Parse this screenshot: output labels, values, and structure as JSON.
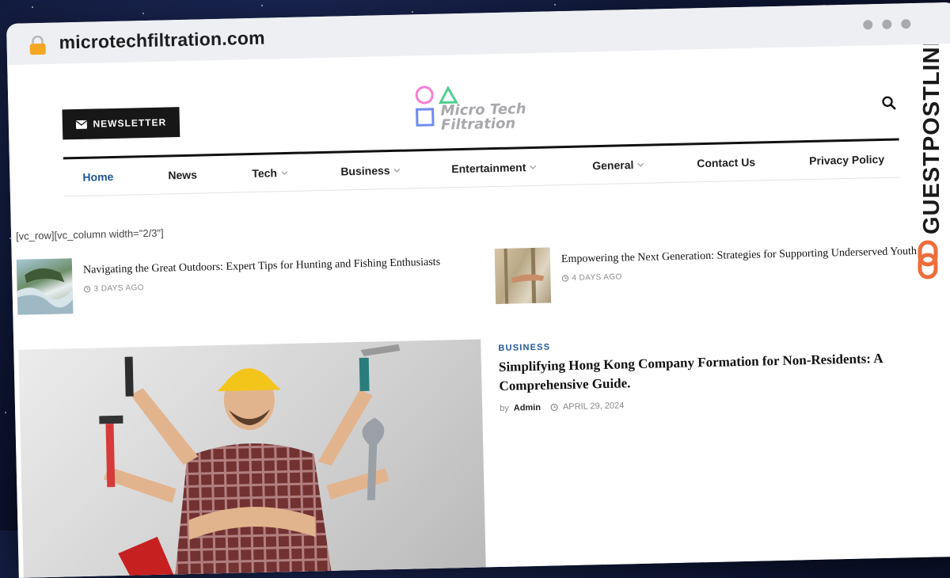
{
  "browser": {
    "url": "microtechfiltration.com"
  },
  "header": {
    "newsletter_label": "NEWSLETTER",
    "logo_line1": "Micro Tech",
    "logo_line2": "Filtration"
  },
  "nav": {
    "items": [
      {
        "label": "Home",
        "active": true
      },
      {
        "label": "News"
      },
      {
        "label": "Tech",
        "dropdown": true
      },
      {
        "label": "Business",
        "dropdown": true
      },
      {
        "label": "Entertainment",
        "dropdown": true
      },
      {
        "label": "General",
        "dropdown": true
      },
      {
        "label": "Contact Us"
      },
      {
        "label": "Privacy Policy"
      }
    ]
  },
  "content": {
    "shortcode": "[vc_row][vc_column width=\"2/3\"]",
    "cards": [
      {
        "title": "Navigating the Great Outdoors: Expert Tips for Hunting and Fishing Enthusiasts",
        "meta": "3 DAYS AGO"
      },
      {
        "title": "Empowering the Next Generation: Strategies for Supporting Underserved Youth",
        "meta": "4 DAYS AGO"
      }
    ],
    "featured": {
      "category": "BUSINESS",
      "title": "Simplifying Hong Kong Company Formation for Non-Residents: A Comprehensive Guide.",
      "by": "by",
      "author": "Admin",
      "date": "APRIL 29, 2024"
    }
  },
  "watermark": {
    "text": "GUESTPOSTLINKS",
    "color": "#ee6d3a"
  }
}
